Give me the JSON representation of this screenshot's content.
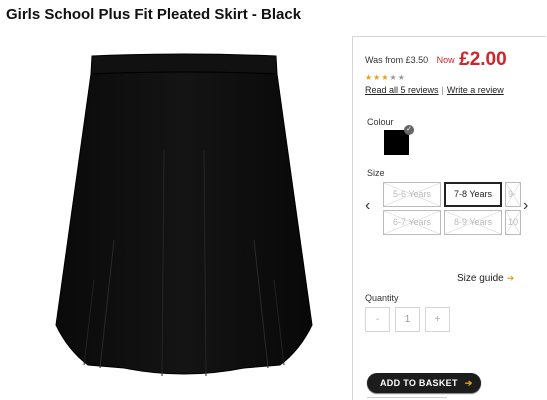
{
  "product": {
    "title": "Girls School Plus Fit Pleated Skirt - Black"
  },
  "pricing": {
    "was": "Was from £3.50",
    "now_label": "Now",
    "now_price": "£2.00"
  },
  "rating": {
    "stars_filled": 3,
    "stars_total": 5,
    "read_reviews": "Read all 5 reviews",
    "write_review": "Write a review"
  },
  "colour": {
    "label": "Colour",
    "selected_swatch": "#000000"
  },
  "size": {
    "label": "Size",
    "options": [
      {
        "label": "5-6 Years",
        "available": false
      },
      {
        "label": "7-8 Years",
        "available": true,
        "selected": true
      },
      {
        "label": "9-",
        "available": false
      },
      {
        "label": "6-7 Years",
        "available": false
      },
      {
        "label": "8-9 Years",
        "available": false
      },
      {
        "label": "10",
        "available": false
      }
    ],
    "guide": "Size guide"
  },
  "quantity": {
    "label": "Quantity",
    "minus": "-",
    "value": "1",
    "plus": "+"
  },
  "cart": {
    "add_label": "ADD TO BASKET"
  }
}
